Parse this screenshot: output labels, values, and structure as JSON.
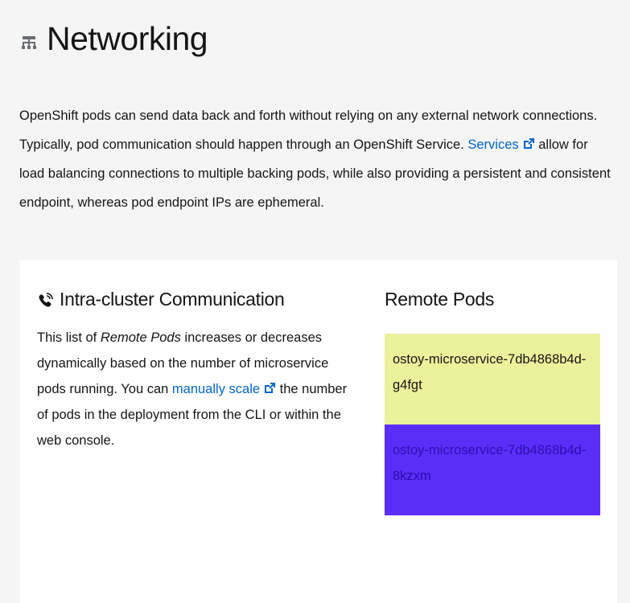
{
  "page": {
    "title": "Networking",
    "icon": "network-icon"
  },
  "intro": {
    "text_before_link": "OpenShift pods can send data back and forth without relying on any external network connections. Typically, pod communication should happen through an OpenShift Service.",
    "link_label": "Services",
    "text_after_link": "allow for load balancing connections to multiple backing pods, while also providing a persistent and consistent endpoint, whereas pod endpoint IPs are ephemeral."
  },
  "intra_cluster": {
    "title": "Intra-cluster Communication",
    "icon": "phone-volume-icon",
    "text_1": "This list of ",
    "emphasis": "Remote Pods",
    "text_2": " increases or decreases dynamically based on the number of microservice pods running. You can ",
    "link_label": "manually scale",
    "text_3": " the number of pods in the deployment from the CLI or within the web console."
  },
  "remote_pods": {
    "title": "Remote Pods",
    "pods": [
      {
        "name": "ostoy-microservice-7db4868b4d-g4fgt",
        "bg_color": "#eaf29b",
        "text_color": "#151515"
      },
      {
        "name": "ostoy-microservice-7db4868b4d-8kzxm",
        "bg_color": "#5b2ef8",
        "text_color": "#2b0fb0"
      }
    ]
  },
  "colors": {
    "link": "#0066cc",
    "page_bg": "#f5f5f5",
    "card_bg": "#ffffff"
  }
}
